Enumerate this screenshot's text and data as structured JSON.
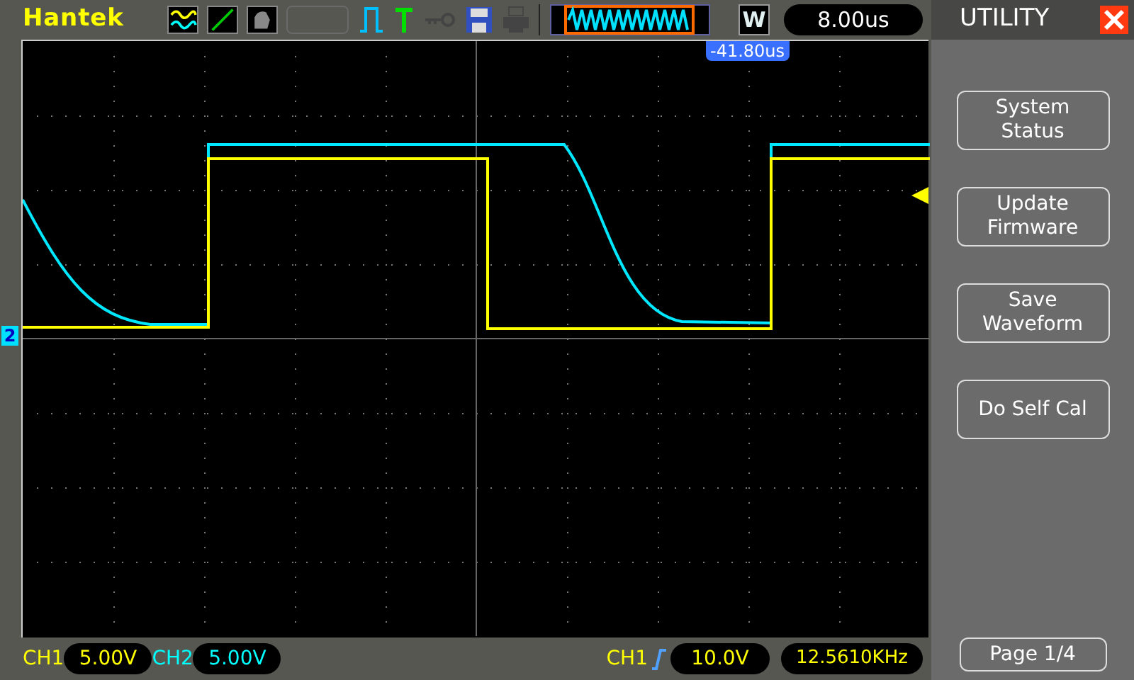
{
  "header": {
    "brand": "Hantek",
    "timebase_mode": "W",
    "timebase": "8.00us"
  },
  "screen": {
    "trigger_offset": "-41.80us",
    "channel_marker": "2"
  },
  "footer": {
    "channels": [
      {
        "label": "CH1",
        "scale": "5.00V",
        "color": "#ffff00"
      },
      {
        "label": "CH2",
        "scale": "5.00V",
        "color": "#00ffff"
      }
    ],
    "trigger": {
      "source": "CH1",
      "level": "10.0V",
      "frequency": "12.5610KHz"
    }
  },
  "menu": {
    "title": "UTILITY",
    "buttons": [
      "System\nStatus",
      "Update\nFirmware",
      "Save\nWaveform",
      "Do Self Cal"
    ],
    "page": "Page 1/4"
  }
}
